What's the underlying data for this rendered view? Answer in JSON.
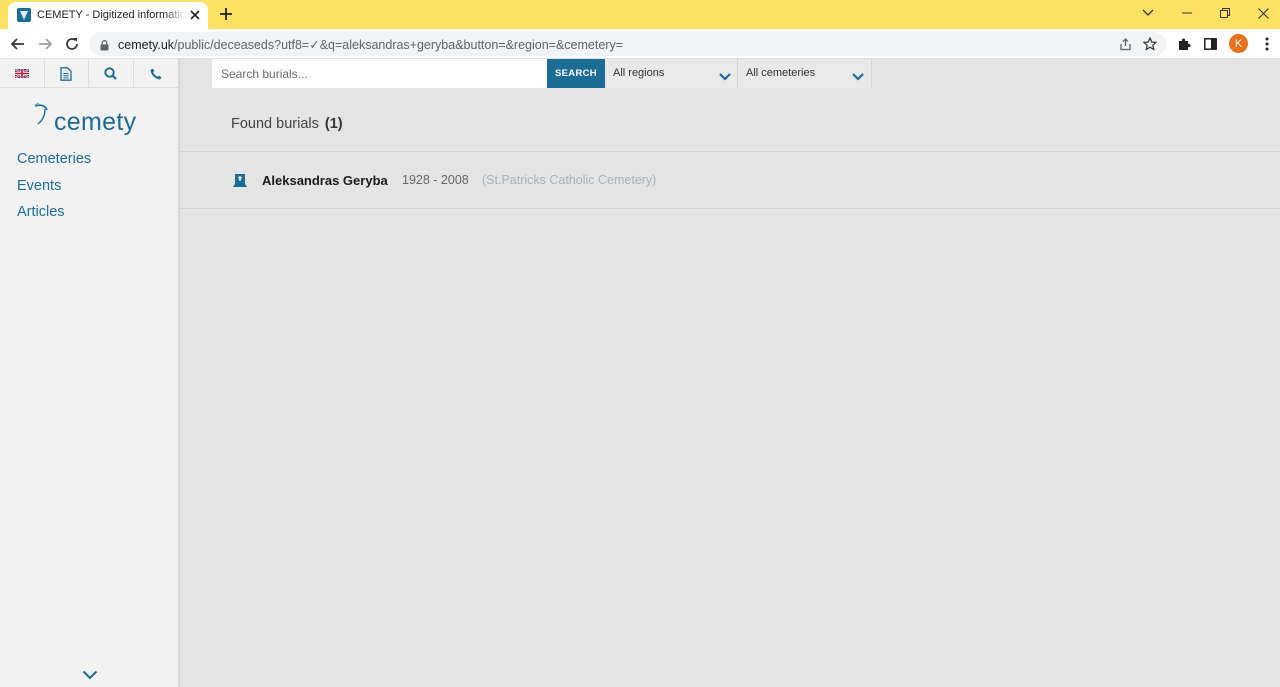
{
  "browser": {
    "tab_title": "CEMETY - Digitized information",
    "url_domain": "cemety.uk",
    "url_path": "/public/deceaseds?utf8=✓&q=aleksandras+geryba&button=&region=&cemetery=",
    "profile_initial": "K"
  },
  "sidebar": {
    "logo_text": "cemety",
    "icons": [
      "uk-flag-icon",
      "document-icon",
      "search-icon",
      "phone-icon"
    ],
    "nav": [
      "Cemeteries",
      "Events",
      "Articles"
    ]
  },
  "search": {
    "placeholder": "Search burials...",
    "button_label": "SEARCH",
    "region_value": "All regions",
    "cemetery_value": "All cemeteries"
  },
  "results": {
    "heading": "Found burials",
    "count": "(1)",
    "items": [
      {
        "name": "Aleksandras Geryba",
        "years": "1928 - 2008",
        "cemetery": "(St.Patricks Catholic Cemetery)"
      }
    ]
  },
  "colors": {
    "brand": "#1b6d96",
    "tabbar": "#fde163"
  }
}
